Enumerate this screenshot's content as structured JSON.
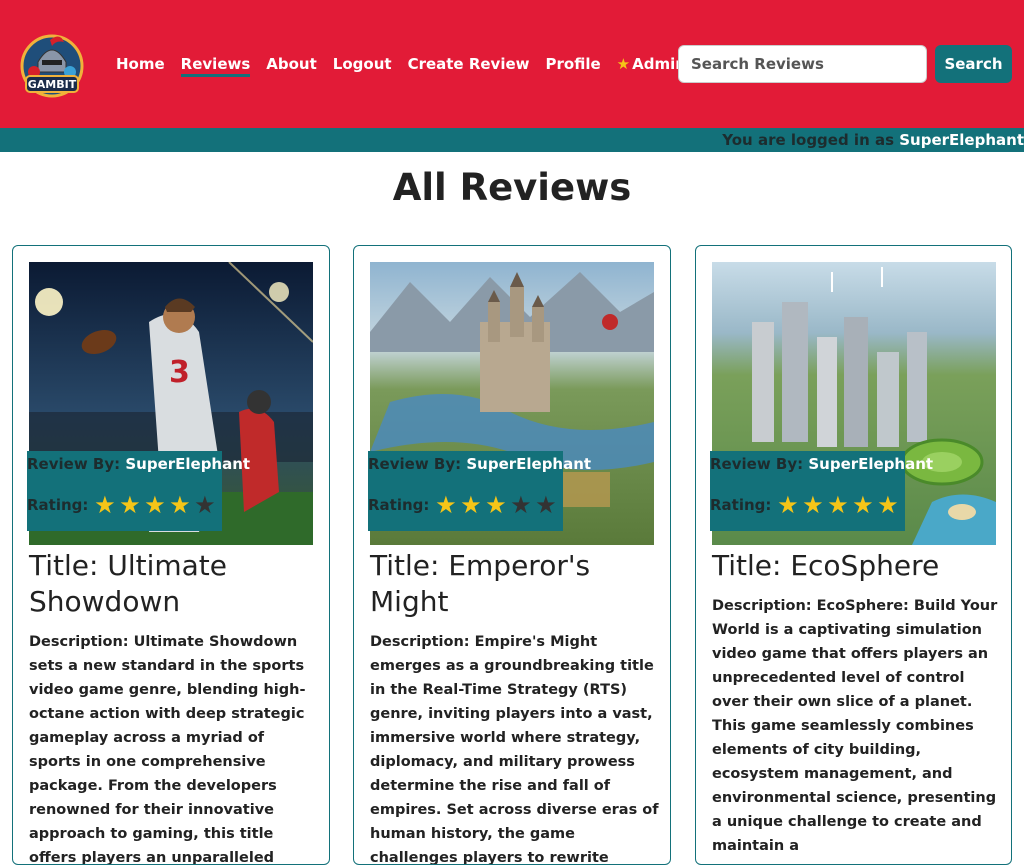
{
  "brand": {
    "logo_text": "GAMBIT",
    "logo_small": "GAMER'S"
  },
  "nav": {
    "home": "Home",
    "reviews": "Reviews",
    "about": "About",
    "logout": "Logout",
    "create_review": "Create Review",
    "profile": "Profile",
    "admin": "Admin"
  },
  "search": {
    "placeholder": "Search Reviews",
    "button": "Search"
  },
  "status": {
    "prefix": "You are logged in as ",
    "username": "SuperElephant"
  },
  "page": {
    "heading": "All Reviews"
  },
  "reviews": [
    {
      "by_label": "Review By:",
      "author": "SuperElephant",
      "rating_label": "Rating:",
      "rating": 4,
      "title": "Title: Ultimate Showdown",
      "description": "Description: Ultimate Showdown sets a new standard in the sports video game genre, blending high-octane action with deep strategic gameplay across a myriad of sports in one comprehensive package. From the developers renowned for their innovative approach to gaming, this title offers players an unparalleled"
    },
    {
      "by_label": "Review By:",
      "author": "SuperElephant",
      "rating_label": "Rating:",
      "rating": 3,
      "title": "Title: Emperor's Might",
      "description": "Description: Empire's Might emerges as a groundbreaking title in the Real-Time Strategy (RTS) genre, inviting players into a vast, immersive world where strategy, diplomacy, and military prowess determine the rise and fall of empires. Set across diverse eras of human history, the game challenges players to rewrite"
    },
    {
      "by_label": "Review By:",
      "author": "SuperElephant",
      "rating_label": "Rating:",
      "rating": 5,
      "title": "Title: EcoSphere",
      "description": "Description: EcoSphere: Build Your World is a captivating simulation video game that offers players an unprecedented level of control over their own slice of a planet. This game seamlessly combines elements of city building, ecosystem management, and environmental science, presenting a unique challenge to create and maintain a"
    }
  ],
  "colors": {
    "brand_red": "#e21b37",
    "teal": "#13717a",
    "star": "#f5c518"
  },
  "icons": {
    "admin": "star-icon",
    "rating": "star-icon"
  }
}
